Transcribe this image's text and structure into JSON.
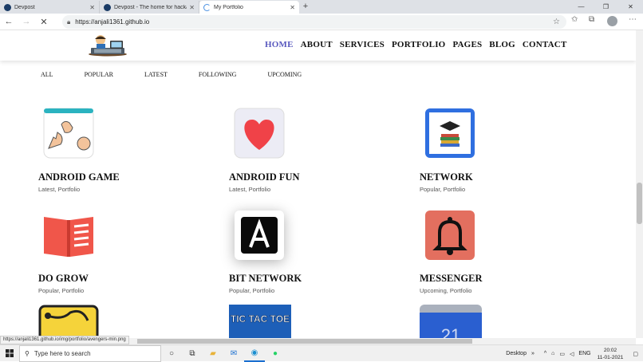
{
  "browser": {
    "tabs": [
      {
        "title": "Devpost"
      },
      {
        "title": "Devpost - The home for hackatho"
      },
      {
        "title": "My Portfolio"
      }
    ],
    "url": "https://anjali1361.github.io",
    "status_url": "https://anjali1361.github.io/img/portfolio/avengers-min.png"
  },
  "nav": {
    "items": [
      "HOME",
      "ABOUT",
      "SERVICES",
      "PORTFOLIO",
      "PAGES",
      "BLOG",
      "CONTACT"
    ]
  },
  "filters": [
    "ALL",
    "POPULAR",
    "LATEST",
    "FOLLOWING",
    "UPCOMING"
  ],
  "portfolio": [
    {
      "title": "ANDROID GAME",
      "cats": "Latest, Portfolio",
      "icon": "rock-paper-scissors-icon"
    },
    {
      "title": "ANDROID FUN",
      "cats": "Latest, Portfolio",
      "icon": "heart-icon"
    },
    {
      "title": "NETWORK",
      "cats": "Popular, Portfolio",
      "icon": "graduation-books-icon"
    },
    {
      "title": "DO GROW",
      "cats": "Popular, Portfolio",
      "icon": "open-book-icon"
    },
    {
      "title": "BIT NETWORK",
      "cats": "Popular, Portfolio",
      "icon": "letter-a-icon"
    },
    {
      "title": "MESSENGER",
      "cats": "Upcoming, Portfolio",
      "icon": "bell-icon"
    }
  ],
  "partial_icons": {
    "tictactoe": "TIC TAC TOE",
    "calendar": "21"
  },
  "taskbar": {
    "search_placeholder": "Type here to search",
    "desktop": "Desktop",
    "lang": "ENG",
    "time": "20:02",
    "date": "11-01-2021"
  },
  "colors": {
    "accent": "#5a5abf"
  }
}
